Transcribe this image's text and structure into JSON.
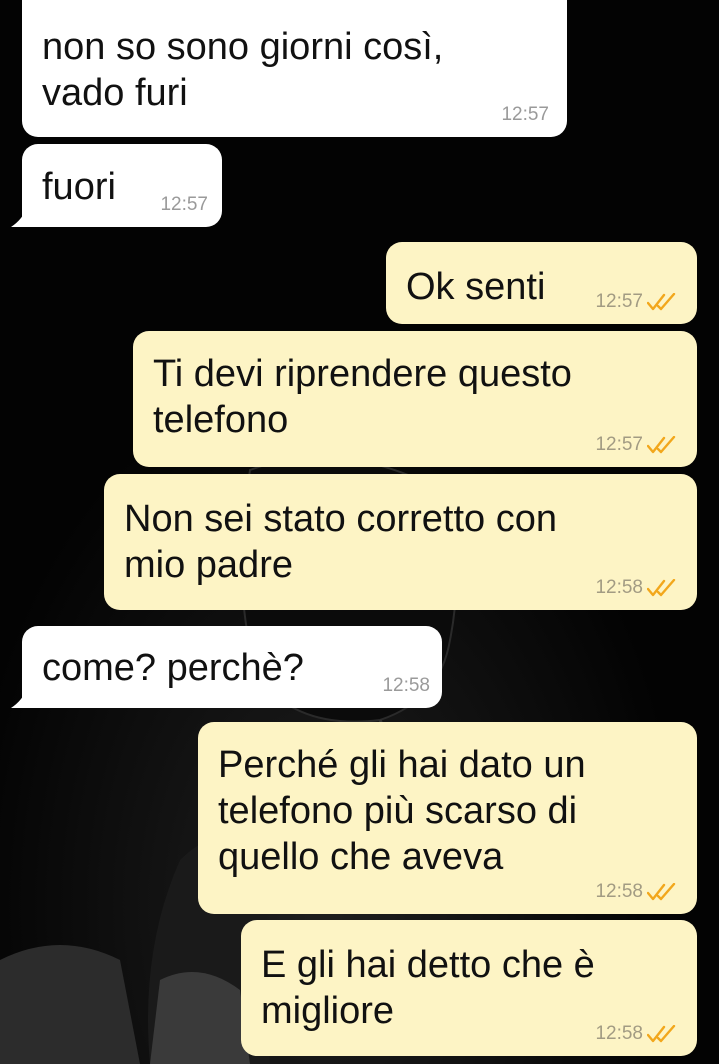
{
  "colors": {
    "incoming_bubble": "#ffffff",
    "outgoing_bubble": "#fdf4c5",
    "read_ticks": "#f2a71c",
    "timestamp": "#9a9a9a",
    "background": "#030303"
  },
  "messages": [
    {
      "direction": "in",
      "text": "non so sono giorni così,\nvado furi",
      "time": "12:57"
    },
    {
      "direction": "in",
      "text": "fuori",
      "time": "12:57"
    },
    {
      "direction": "out",
      "text": "Ok senti",
      "time": "12:57",
      "status_icon": "double-check-icon"
    },
    {
      "direction": "out",
      "text": "Ti devi riprendere questo\ntelefono",
      "time": "12:57",
      "status_icon": "double-check-icon"
    },
    {
      "direction": "out",
      "text": "Non sei stato corretto con\nmio padre",
      "time": "12:58",
      "status_icon": "double-check-icon"
    },
    {
      "direction": "in",
      "text": "come? perchè?",
      "time": "12:58"
    },
    {
      "direction": "out",
      "text": "Perché gli hai dato un\ntelefono più scarso di\nquello che aveva",
      "time": "12:58",
      "status_icon": "double-check-icon"
    },
    {
      "direction": "out",
      "text": "E gli hai detto che è\nmigliore",
      "time": "12:58",
      "status_icon": "double-check-icon"
    }
  ]
}
